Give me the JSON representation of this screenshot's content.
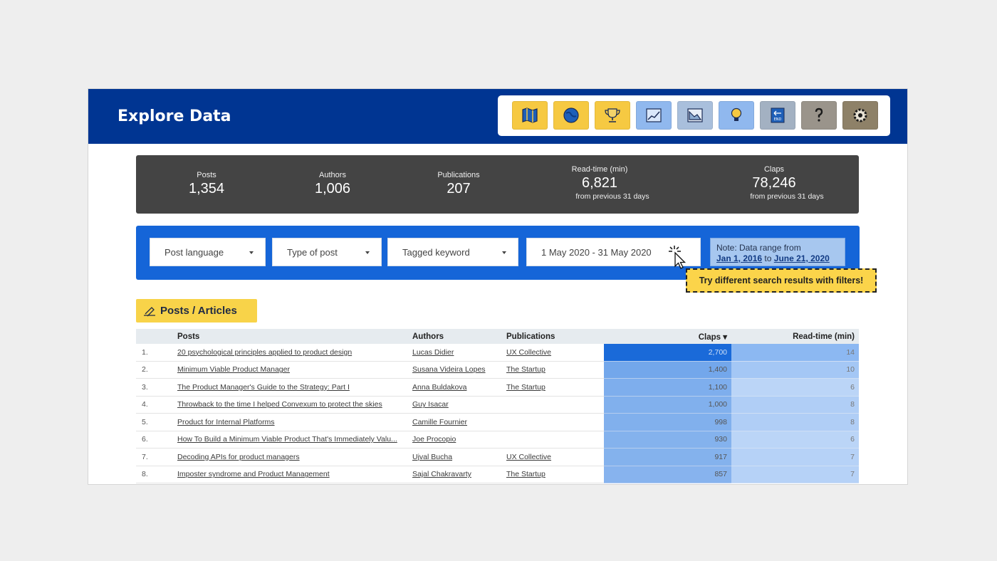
{
  "header": {
    "title": "Explore Data"
  },
  "toolbar": {
    "buttons": [
      {
        "icon": "map-icon",
        "color": "#f6c942"
      },
      {
        "icon": "globe-icon",
        "color": "#f6c942"
      },
      {
        "icon": "trophy-icon",
        "color": "#f6c942"
      },
      {
        "icon": "line-chart-icon",
        "color": "#90b8ee"
      },
      {
        "icon": "area-chart-icon",
        "color": "#a9bfdc"
      },
      {
        "icon": "lightbulb-icon",
        "color": "#90b8ee"
      },
      {
        "icon": "end-icon",
        "color": "#a3b1c2"
      },
      {
        "icon": "question-icon",
        "color": "#9a948b"
      },
      {
        "icon": "gear-icon",
        "color": "#8e8168"
      }
    ]
  },
  "stats": [
    {
      "label": "Posts",
      "value": "1,354",
      "sub": ""
    },
    {
      "label": "Authors",
      "value": "1,006",
      "sub": ""
    },
    {
      "label": "Publications",
      "value": "207",
      "sub": ""
    },
    {
      "label": "Read-time (min)",
      "value": "6,821",
      "sub": "from previous 31 days"
    },
    {
      "label": "Claps",
      "value": "78,246",
      "sub": "from previous 31 days"
    }
  ],
  "filters": {
    "language": "Post language",
    "type": "Type of post",
    "keyword": "Tagged keyword",
    "date": "1 May 2020 - 31 May 2020"
  },
  "note": {
    "prefix": "Note: Data range from",
    "from": "Jan 1, 2016",
    "to_word": "to",
    "to": "June 21, 2020"
  },
  "tooltip": "Try different search results with filters!",
  "section": {
    "label": "Posts / Articles"
  },
  "table": {
    "columns": [
      "",
      "Posts",
      "Authors",
      "Publications",
      "Claps",
      "Read-time (min)"
    ],
    "rows": [
      [
        "1.",
        "20 psychological principles applied to product design",
        "Lucas Didier",
        "UX Collective",
        "2,700",
        "14"
      ],
      [
        "2.",
        "Minimum Viable Product Manager",
        "Susana Videira Lopes",
        "The Startup",
        "1,400",
        "10"
      ],
      [
        "3.",
        "The Product Manager's Guide to the Strategy: Part I",
        "Anna Buldakova",
        "The Startup",
        "1,100",
        "6"
      ],
      [
        "4.",
        "Throwback to the time I helped Convexum to protect the skies",
        "Guy Isacar",
        "",
        "1,000",
        "8"
      ],
      [
        "5.",
        "Product for Internal Platforms",
        "Camille Fournier",
        "",
        "998",
        "8"
      ],
      [
        "6.",
        "How To Build a Minimum Viable Product That's Immediately Valu...",
        "Joe Procopio",
        "",
        "930",
        "6"
      ],
      [
        "7.",
        "Decoding APIs for product managers",
        "Ujval Bucha",
        "UX Collective",
        "917",
        "7"
      ],
      [
        "8.",
        "Imposter syndrome and Product Management",
        "Sajal Chakravarty",
        "The Startup",
        "857",
        "7"
      ]
    ],
    "sort_indicator": "▾"
  }
}
